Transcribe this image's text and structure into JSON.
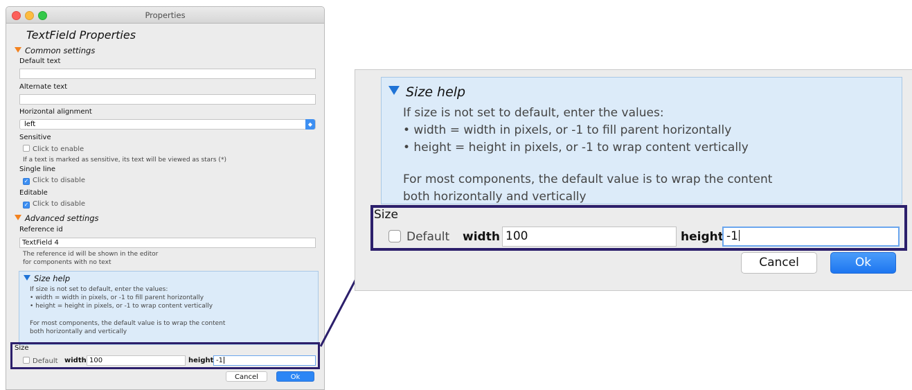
{
  "window": {
    "title": "Properties"
  },
  "left": {
    "heading": "TextField Properties",
    "common_settings": "Common settings",
    "default_text_label": "Default text",
    "default_text_value": "",
    "alternate_text_label": "Alternate text",
    "alternate_text_value": "",
    "h_align_label": "Horizontal alignment",
    "h_align_value": "left",
    "sensitive_label": "Sensitive",
    "sensitive_checkbox": "Click to enable",
    "sensitive_hint": "If a text is marked as sensitive, its text will be viewed as stars (*)",
    "single_line_label": "Single line",
    "single_line_checkbox": "Click to disable",
    "editable_label": "Editable",
    "editable_checkbox": "Click to disable",
    "advanced_settings": "Advanced settings",
    "reference_id_label": "Reference id",
    "reference_id_value": "TextField 4",
    "reference_hint_1": "The reference id will be shown in the editor",
    "reference_hint_2": "for components with no text",
    "size_help_title": "Size help",
    "size_help_lines": [
      "If size is not set to default, enter the values:",
      "• width = width in pixels, or -1 to fill parent horizontally",
      "• height = height in pixels, or -1 to wrap content vertically",
      "For most components, the default value is to wrap the content",
      "both horizontally and vertically"
    ],
    "size_label": "Size",
    "default_checkbox": "Default",
    "width_label": "width",
    "width_value": "100",
    "height_label": "height",
    "height_value": "-1",
    "cancel": "Cancel",
    "ok": "Ok"
  },
  "zoom": {
    "size_help_title": "Size help",
    "size_help_lines": [
      "If size is not set to default, enter the values:",
      "• width = width in pixels, or -1 to fill parent horizontally",
      "• height = height in pixels, or -1 to wrap content vertically",
      "For most components, the default value is to wrap the content",
      "both horizontally and vertically"
    ],
    "size_label": "Size",
    "default_checkbox": "Default",
    "width_label": "width",
    "width_value": "100",
    "height_label": "height",
    "height_value": "-1",
    "cancel": "Cancel",
    "ok": "Ok"
  },
  "colors": {
    "highlight_frame": "#2c1f6b",
    "accent": "#2c86f5",
    "section_triangle": "#f3821f",
    "help_background": "#dcebf9"
  }
}
